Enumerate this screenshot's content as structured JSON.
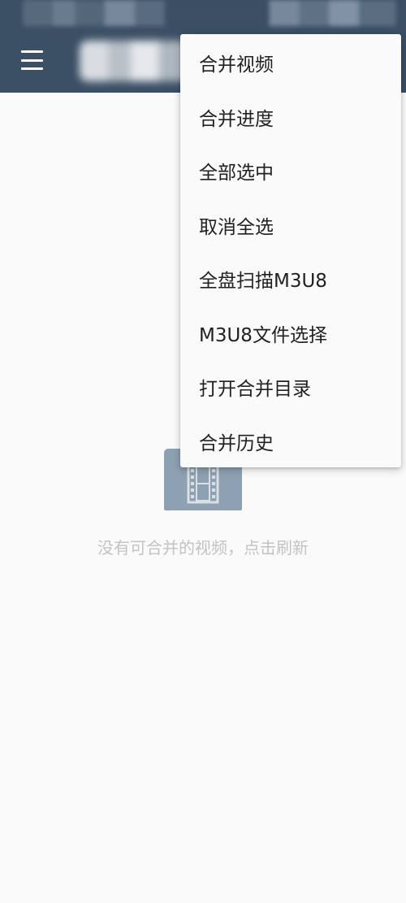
{
  "app_bar": {
    "menu_icon": "hamburger-menu-icon",
    "title": ""
  },
  "overflow_menu": {
    "items": [
      {
        "label": "合并视频"
      },
      {
        "label": "合并进度"
      },
      {
        "label": "全部选中"
      },
      {
        "label": "取消全选"
      },
      {
        "label": "全盘扫描M3U8"
      },
      {
        "label": "M3U8文件选择"
      },
      {
        "label": "打开合并目录"
      },
      {
        "label": "合并历史"
      }
    ]
  },
  "empty_state": {
    "icon": "video-folder-icon",
    "message": "没有可合并的视频，点击刷新"
  },
  "colors": {
    "app_bar": "#3b4f65",
    "background": "#fafafa",
    "menu_text": "#212121",
    "empty_text": "#c3c3c3",
    "folder_icon": "#8ea1b2"
  }
}
